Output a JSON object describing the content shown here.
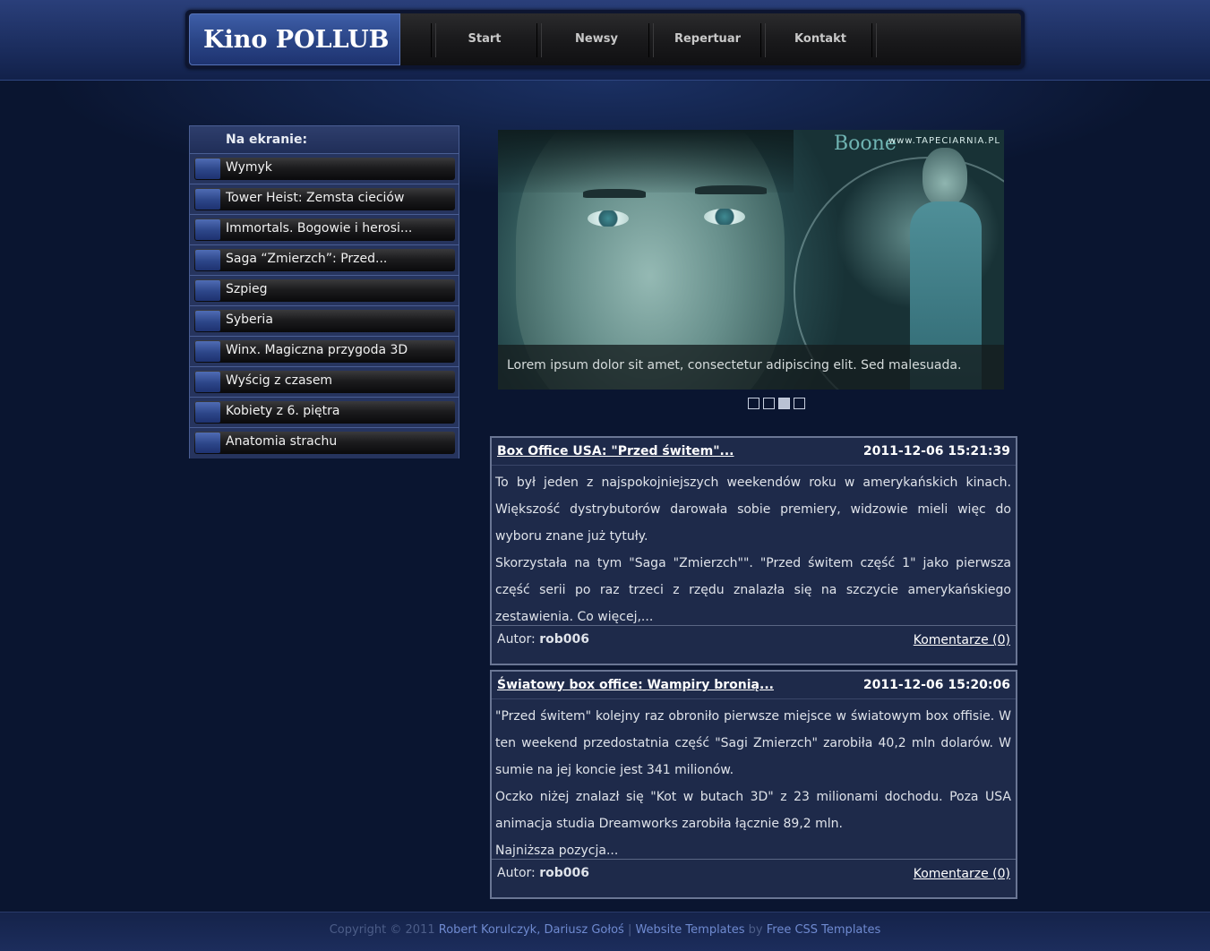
{
  "header": {
    "logo": "Kino POLLUB",
    "nav": [
      "Start",
      "Newsy",
      "Repertuar",
      "Kontakt"
    ]
  },
  "sidebar": {
    "title": "Na ekranie:",
    "items": [
      "Wymyk",
      "Tower Heist: Zemsta cieciów",
      "Immortals. Bogowie i herosi...",
      "Saga “Zmierzch”: Przed...",
      "Szpieg",
      "Syberia",
      "Winx. Magiczna przygoda 3D",
      "Wyścig z czasem",
      "Kobiety z 6. piętra",
      "Anatomia strachu"
    ]
  },
  "slider": {
    "brand": "Boone",
    "watermark": "www.TAPECIARNIA.PL",
    "caption": "Lorem ipsum dolor sit amet, consectetur adipiscing elit. Sed malesuada.",
    "slide_count": 4,
    "active_slide": 3
  },
  "articles": [
    {
      "title": "Box Office USA: \"Przed świtem\"...",
      "date": "2011-12-06 15:21:39",
      "paragraphs": [
        " To był jeden z najspokojniejszych weekendów roku w amerykańskich kinach. Większość dystrybutorów darowała sobie premiery, widzowie mieli więc do wyboru znane już tytuły.",
        "Skorzystała na tym \"Saga \"Zmierzch\"\". \"Przed świtem część 1\" jako pierwsza część serii po raz trzeci z rzędu znalazła się na szczycie amerykańskiego zestawienia. Co więcej,..."
      ],
      "author_label": "Autor:",
      "author": "rob006",
      "comments": "Komentarze (0)"
    },
    {
      "title": "Światowy box office: Wampiry bronią...",
      "date": "2011-12-06 15:20:06",
      "paragraphs": [
        " \"Przed świtem\" kolejny raz obroniło pierwsze miejsce w światowym box offisie. W ten weekend przedostatnia część \"Sagi Zmierzch\" zarobiła 40,2 mln dolarów. W sumie na jej koncie jest 341 milionów.",
        "Oczko niżej znalazł się \"Kot w butach 3D\" z 23 milionami dochodu. Poza USA animacja studia Dreamworks zarobiła łącznie 89,2 mln.",
        "Najniższa pozycja..."
      ],
      "author_label": "Autor:",
      "author": "rob006",
      "comments": "Komentarze (0)"
    }
  ],
  "footer": {
    "copyright": "Copyright © 2011 ",
    "authors": "Robert Korulczyk, Dariusz Gołoś",
    "sep": " | ",
    "templates": "Website Templates",
    "by": " by ",
    "free": "Free CSS Templates"
  },
  "colors": {
    "background": "#0a1530",
    "nav_bar": "#1a1a1c",
    "logo_bg": "#2b4688",
    "sidebar_border": "#4a5e94",
    "article_bg": "#1e2a4a",
    "footer_link": "#6f8ad0"
  }
}
